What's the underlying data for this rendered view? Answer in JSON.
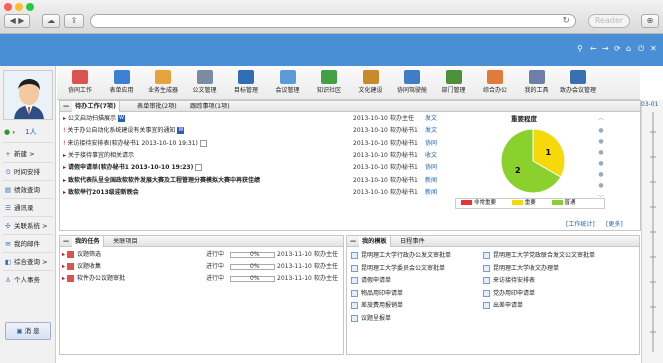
{
  "browser": {
    "reader_label": "Reader"
  },
  "user": {
    "name": "1人"
  },
  "sidebar": {
    "items": [
      {
        "icon": "+",
        "label": "新建 >"
      },
      {
        "icon": "⏲",
        "label": "时间安排"
      },
      {
        "icon": "▤",
        "label": "绩效查询"
      },
      {
        "icon": "☰",
        "label": "通讯录"
      },
      {
        "icon": "✣",
        "label": "关联系统 >"
      },
      {
        "icon": "✉",
        "label": "我的邮件"
      },
      {
        "icon": "◧",
        "label": "综合查询 >"
      },
      {
        "icon": "♙",
        "label": "个人事务"
      }
    ],
    "message_button": "消 息"
  },
  "toolbar": {
    "items": [
      "协同工作",
      "表单应用",
      "业务生成器",
      "公文管理",
      "目标管理",
      "会议管理",
      "知识社区",
      "文化建设",
      "协同驾驶舱",
      "部门管理",
      "综合办公",
      "我的工具",
      "致办会议管理"
    ]
  },
  "topright": {
    "date": "03-01"
  },
  "work_panel": {
    "tabs": [
      "待办工作(7项)",
      "表单审批(2项)",
      "跟踪事项(1项)"
    ],
    "rows": [
      {
        "title": "公文启动扫描展示",
        "w": "W",
        "date": "2013-10-10",
        "sender": "软办主任",
        "type": "发文"
      },
      {
        "title": "关于办公自动化系统建设有关事宜的通知",
        "w": "W",
        "date": "2013-10-10",
        "sender": "软办秘书1",
        "type": "发文"
      },
      {
        "title": "来访接待安排表(软办秘书1 2013-10-10 19:31)",
        "w": "",
        "date": "2013-10-10",
        "sender": "软办秘书1",
        "type": "协同"
      },
      {
        "title": "关于接待事宜的相关请示",
        "w": "",
        "date": "2013-10-10",
        "sender": "软办秘书1",
        "type": "收文"
      },
      {
        "title": "请假申请单(软办秘书1 2013-10-10 19:23)",
        "w": "",
        "date": "2013-10-10",
        "sender": "软办秘书1",
        "type": "协同"
      },
      {
        "title": "致软代表队呈全国政软软件发展大赛及工程管理分赛模拟大赛中再获佳绩",
        "w": "",
        "date": "2013-10-10",
        "sender": "软办秘书1",
        "type": "新闻"
      },
      {
        "title": "致软举行2013级迎新晚会",
        "w": "",
        "date": "2013-10-10",
        "sender": "软办秘书1",
        "type": "新闻"
      }
    ],
    "footer": [
      "[工作统计]",
      "[更多]"
    ]
  },
  "chart_data": {
    "type": "pie",
    "title": "重要程度",
    "categories": [
      "非常重要",
      "重要",
      "普通"
    ],
    "values": [
      0,
      1,
      2
    ],
    "colors": [
      "#e8323a",
      "#f5d90a",
      "#8bd12d"
    ],
    "legend_position": "bottom"
  },
  "tasks_panel": {
    "tabs": [
      "我的任务",
      "关联项目"
    ],
    "rows": [
      {
        "title": "议题筛选",
        "status": "进行中",
        "progress": 0,
        "progress_text": "0%",
        "date": "2013-11-10",
        "owner": "软办主任"
      },
      {
        "title": "议题收集",
        "status": "进行中",
        "progress": 0,
        "progress_text": "0%",
        "date": "2013-11-10",
        "owner": "软办主任"
      },
      {
        "title": "软件办公议题审批",
        "status": "进行中",
        "progress": 0,
        "progress_text": "0%",
        "date": "2013-11-10",
        "owner": "软办主任"
      }
    ]
  },
  "templates_panel": {
    "tabs": [
      "我的模板",
      "日程事件"
    ],
    "items": [
      [
        "昆明理工大学行政办公发文审批单",
        "昆明理工大学党政联合发文公文审批单"
      ],
      [
        "昆明理工大学委员会公文审批单",
        "昆明理工大学收文办理单"
      ],
      [
        "请假申请单",
        "来访接待安排表"
      ],
      [
        "物品用印申请单",
        "党办用印申请单"
      ],
      [
        "差旅费用报销单",
        "出差申请单"
      ],
      [
        "议题呈报单",
        ""
      ]
    ]
  }
}
